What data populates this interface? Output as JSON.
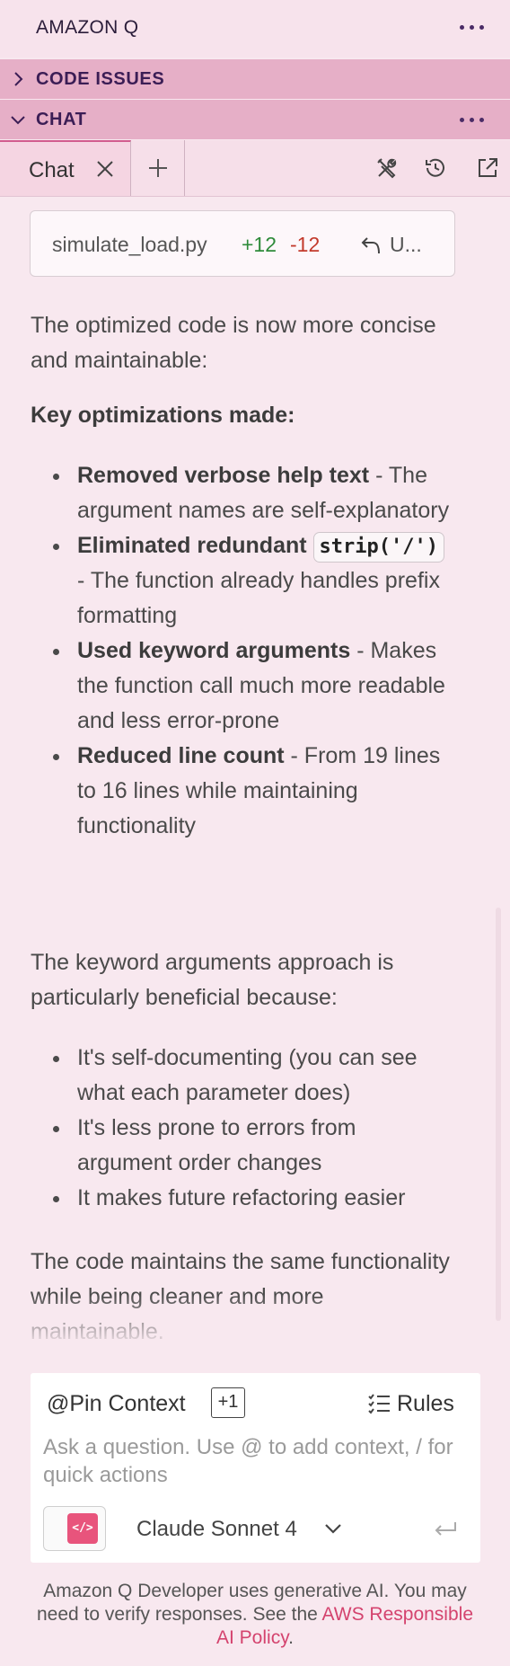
{
  "header": {
    "title": "AMAZON Q",
    "more_icon": "ellipsis-icon"
  },
  "sections": {
    "code_issues": {
      "label": "CODE ISSUES",
      "icon": "chevron-right-icon"
    },
    "chat": {
      "label": "CHAT",
      "icon": "chevron-down-icon"
    }
  },
  "tabs": {
    "active": {
      "label": "Chat",
      "close_icon": "close-icon"
    },
    "add_icon": "plus-icon",
    "tools": [
      "tools-icon",
      "history-icon",
      "open-external-icon"
    ]
  },
  "file_change": {
    "filename": "simulate_load.py",
    "additions": "+12",
    "deletions": "-12",
    "undo_label": "U..."
  },
  "message": {
    "intro": "The optimized code is now more concise and maintainable:",
    "heading": "Key optimizations made:",
    "optimizations": [
      {
        "title": "Removed verbose help text",
        "text": " - The argument names are self-explanatory"
      },
      {
        "title": "Eliminated redundant",
        "code": "strip('/')",
        "text": " - The function already handles prefix formatting"
      },
      {
        "title": "Used keyword arguments",
        "text": " - Makes the function call much more readable and less error-prone"
      },
      {
        "title": "Reduced line count",
        "text": " - From 19 lines to 16 lines while maintaining functionality"
      }
    ],
    "benefit_intro": "The keyword arguments approach is particularly beneficial because:",
    "benefits": [
      "It's self-documenting (you can see what each parameter does)",
      "It's less prone to errors from argument order changes",
      "It makes future refactoring easier"
    ],
    "conclusion": "The code maintains the same functionality while being cleaner and more maintainable."
  },
  "input": {
    "pin_context": "@Pin Context",
    "context_count": "+1",
    "rules_label": "Rules",
    "placeholder": "Ask a question. Use @ to add context, / for quick actions",
    "model": "Claude Sonnet 4",
    "model_button_icon": "code-icon",
    "send_icon": "return-icon"
  },
  "disclaimer": {
    "text": "Amazon Q Developer uses generative AI. You may need to verify responses. See the ",
    "link": "AWS Responsible AI Policy",
    "end": "."
  },
  "colors": {
    "background": "#f8e8ef",
    "section": "#e6afc7",
    "accent": "#d4436e",
    "added": "#2e8b3a",
    "deleted": "#c33a2c"
  }
}
